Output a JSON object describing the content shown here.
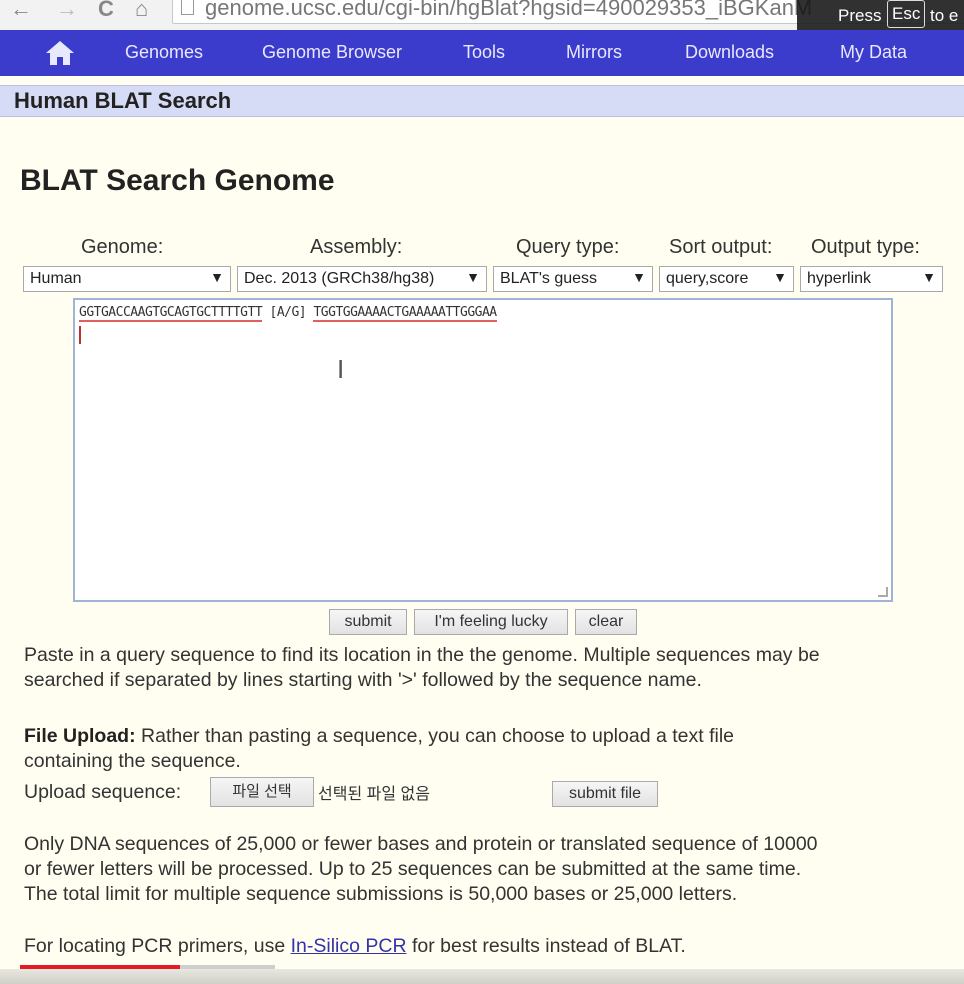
{
  "browser": {
    "back_glyph": "←",
    "forward_glyph": "→",
    "reload_glyph": "C",
    "home_glyph": "⌂",
    "url": "genome.ucsc.edu/cgi-bin/hgBlat?hgsid=490029353_iBGKanM",
    "fullscreen_hint": {
      "press": "Press",
      "key": "Esc",
      "rest": "to e"
    }
  },
  "nav": {
    "items": [
      "Genomes",
      "Genome Browser",
      "Tools",
      "Mirrors",
      "Downloads",
      "My Data"
    ],
    "bg_color": "#3c3ccc"
  },
  "title_bar": "Human BLAT Search",
  "heading": "BLAT Search Genome",
  "form": {
    "labels": [
      "Genome:",
      "Assembly:",
      "Query type:",
      "Sort output:",
      "Output type:"
    ],
    "selects": [
      "Human",
      "Dec. 2013 (GRCh38/hg38)",
      "BLAT's guess",
      "query,score",
      "hyperlink"
    ],
    "sequence_part1": "GGTGACCAAGTGCAGTGCTTTTGTT",
    "sequence_variant": "[A/G]",
    "sequence_part2": "TGGTGGAAAACTGAAAAATTGGGAA",
    "buttons": {
      "submit": "submit",
      "lucky": "I'm feeling lucky",
      "clear": "clear"
    }
  },
  "help1": {
    "line1": "Paste in a query sequence to find its location in the the genome. Multiple sequences may be",
    "line2": "searched if separated by lines starting with '>' followed by the sequence name."
  },
  "upload": {
    "bold": "File Upload:",
    "line1_rest": " Rather than pasting a sequence, you can choose to upload a text file",
    "line2": "containing the sequence.",
    "label": "Upload sequence:",
    "choose_file": "파일 선택",
    "no_file": "선택된 파일 없음",
    "submit_file": "submit file"
  },
  "limits": {
    "line1": "Only DNA sequences of 25,000 or fewer bases and protein or translated sequence of 10000",
    "line2": "or fewer letters will be processed. Up to 25 sequences can be submitted at the same time.",
    "line3": "The total limit for multiple sequence submissions is 50,000 bases or 25,000 letters."
  },
  "pcr": {
    "before": "For locating PCR primers, use ",
    "link": "In-Silico PCR",
    "after": " for best results instead of BLAT."
  },
  "video_progress": {
    "played": 0.17,
    "loaded": 0.27,
    "played_color": "#e31b23"
  }
}
